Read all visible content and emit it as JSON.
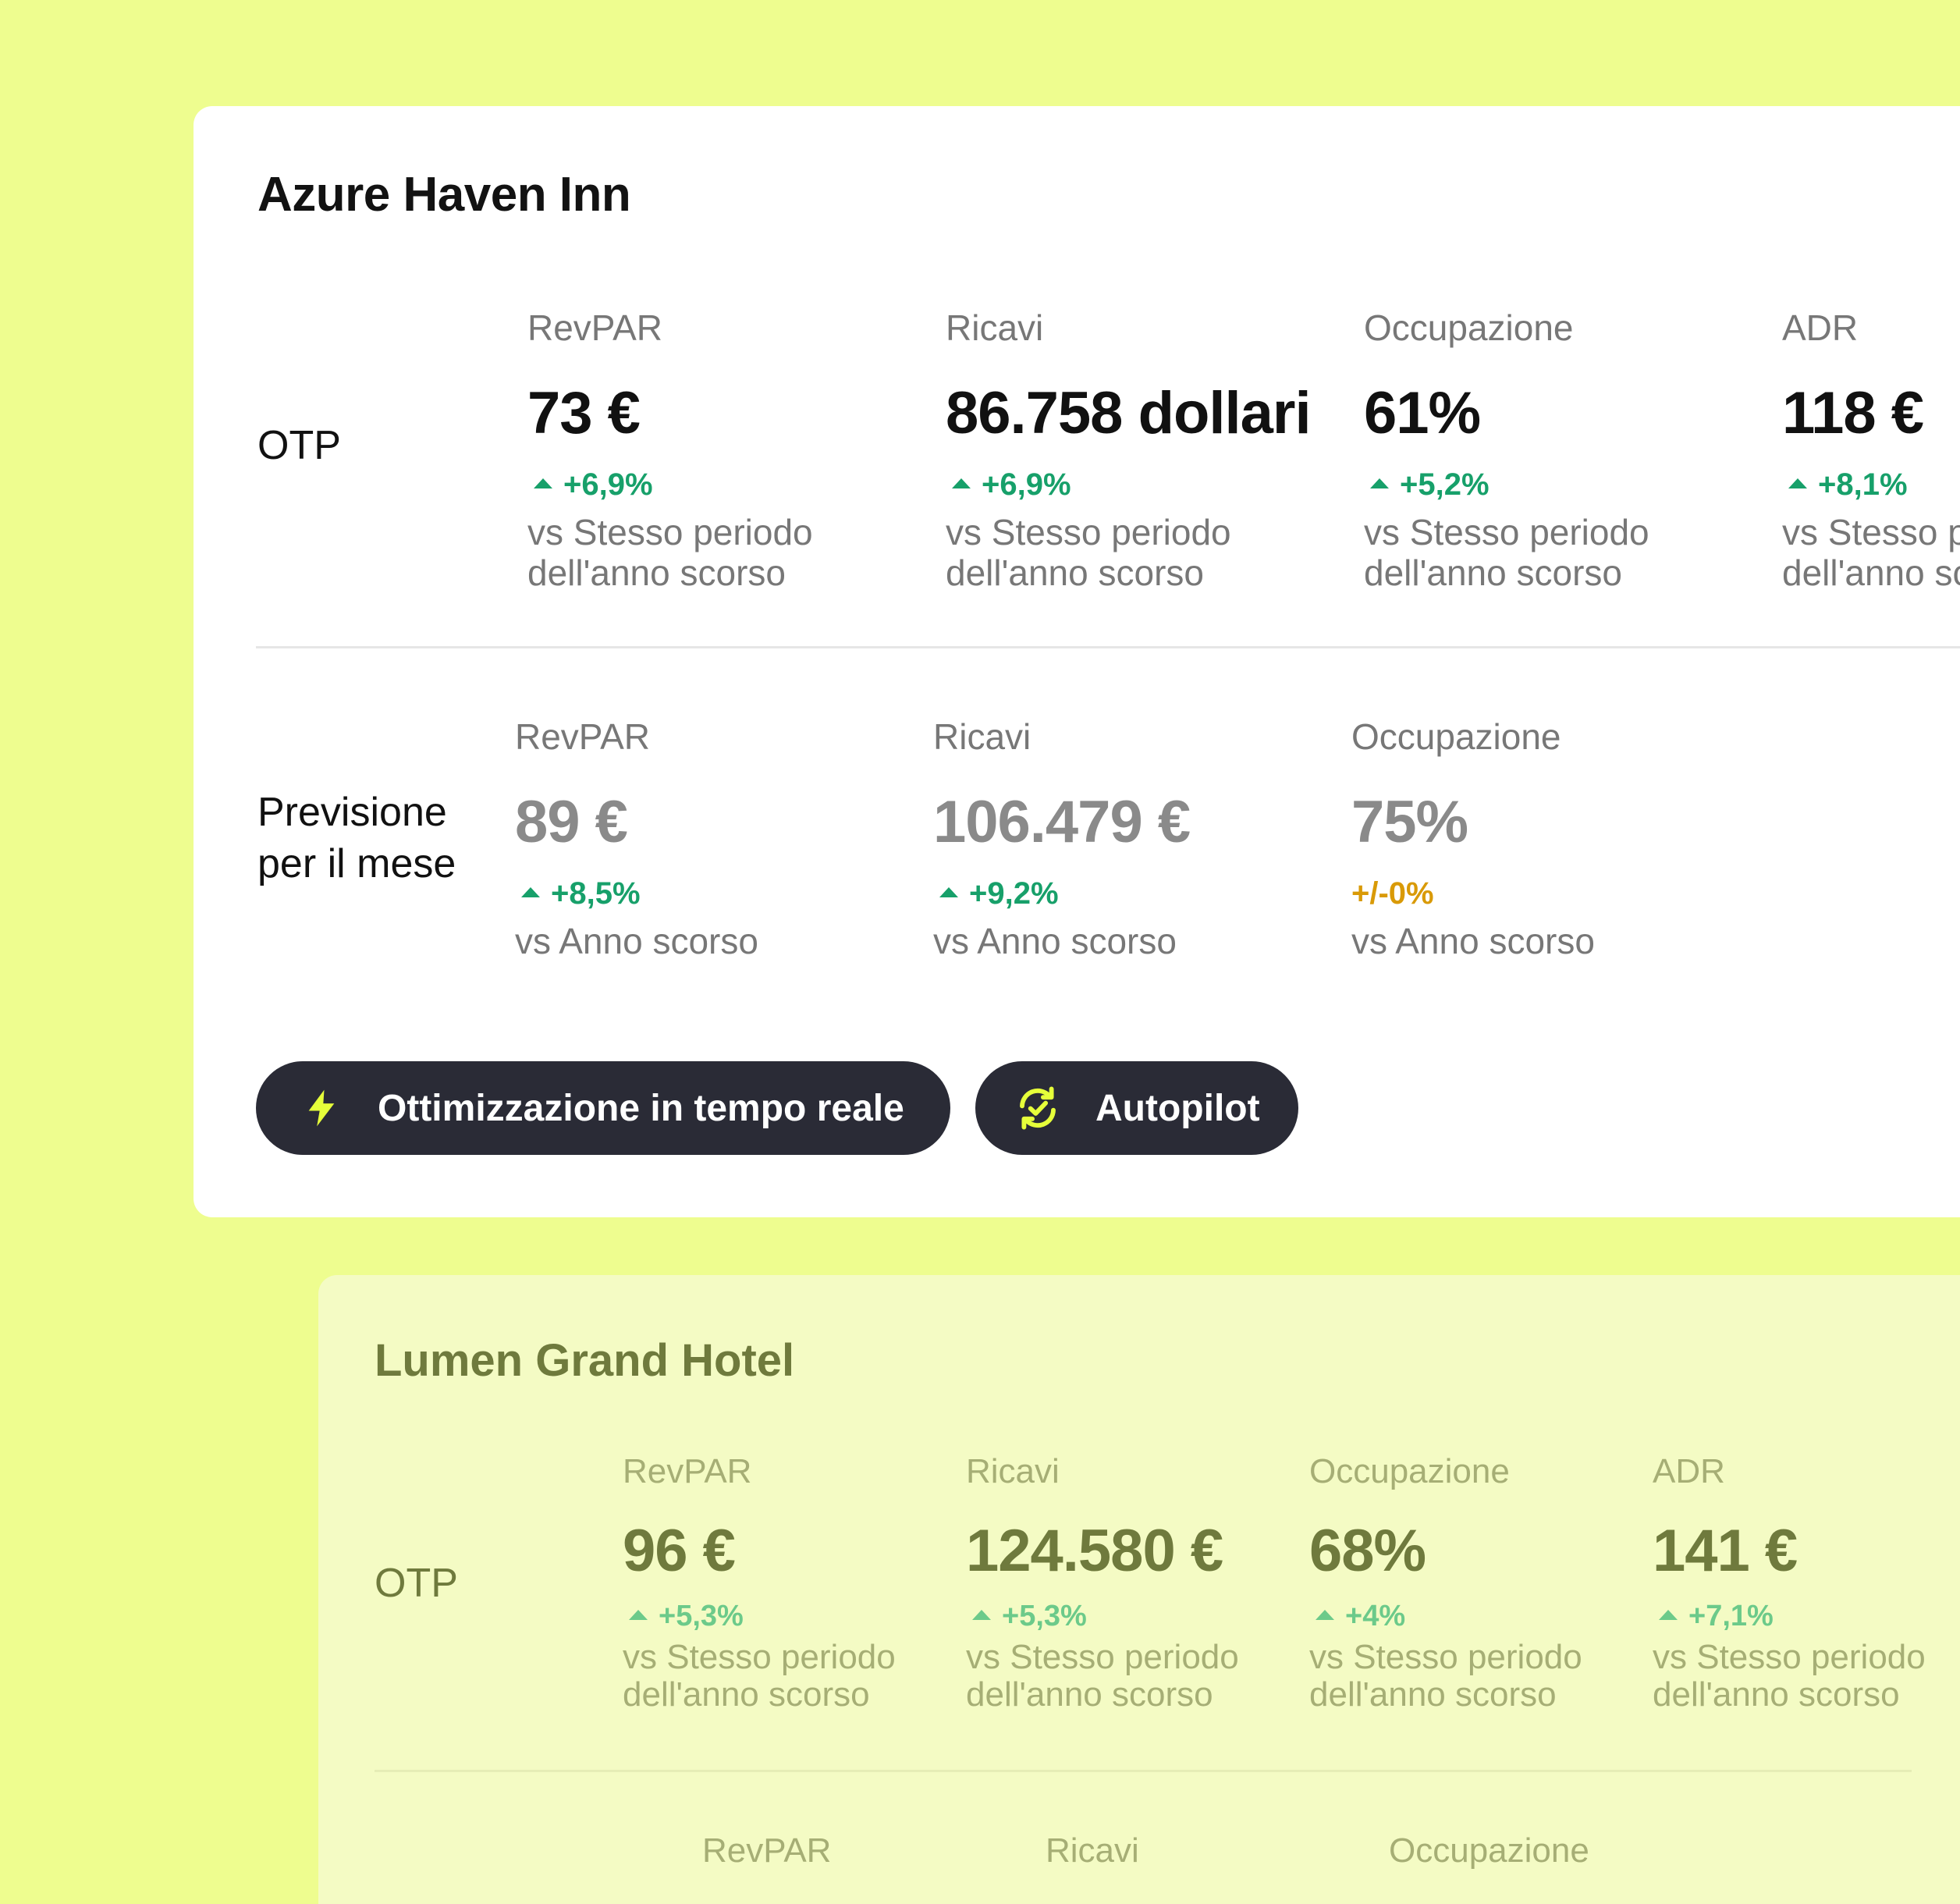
{
  "card1": {
    "hotel": "Azure Haven Inn",
    "otp": {
      "label": "OTP",
      "metrics": [
        {
          "label": "RevPAR",
          "value": "73 €",
          "change": "+6,9%",
          "sub1": "vs Stesso periodo",
          "sub2": "dell'anno scorso"
        },
        {
          "label": "Ricavi",
          "value": "86.758 dollari",
          "change": "+6,9%",
          "sub1": "vs Stesso periodo",
          "sub2": "dell'anno scorso"
        },
        {
          "label": "Occupazione",
          "value": "61%",
          "change": "+5,2%",
          "sub1": "vs Stesso periodo",
          "sub2": "dell'anno scorso"
        },
        {
          "label": "ADR",
          "value": "118 €",
          "change": "+8,1%",
          "sub1": "vs Stesso periodo",
          "sub2": "dell'anno scorso"
        }
      ]
    },
    "forecast": {
      "label_line1": "Previsione",
      "label_line2": "per il mese",
      "metrics": [
        {
          "label": "RevPAR",
          "value": "89 €",
          "change": "+8,5%",
          "sub": "vs Anno scorso"
        },
        {
          "label": "Ricavi",
          "value": "106.479 €",
          "change": "+9,2%",
          "sub": "vs Anno scorso"
        },
        {
          "label": "Occupazione",
          "value": "75%",
          "change": "+/-0%",
          "sub": "vs Anno scorso"
        }
      ]
    },
    "buttons": {
      "realtime": "Ottimizzazione in tempo reale",
      "autopilot": "Autopilot"
    }
  },
  "card2": {
    "hotel": "Lumen Grand Hotel",
    "otp": {
      "label": "OTP",
      "metrics": [
        {
          "label": "RevPAR",
          "value": "96 €",
          "change": "+5,3%",
          "sub1": "vs Stesso periodo",
          "sub2": "dell'anno scorso"
        },
        {
          "label": "Ricavi",
          "value": "124.580 €",
          "change": "+5,3%",
          "sub1": "vs Stesso periodo",
          "sub2": "dell'anno scorso"
        },
        {
          "label": "Occupazione",
          "value": "68%",
          "change": "+4%",
          "sub1": "vs Stesso periodo",
          "sub2": "dell'anno scorso"
        },
        {
          "label": "ADR",
          "value": "141 €",
          "change": "+7,1%",
          "sub1": "vs Stesso periodo",
          "sub2": "dell'anno scorso"
        }
      ]
    },
    "forecast": {
      "metrics": [
        {
          "label": "RevPAR"
        },
        {
          "label": "Ricavi"
        },
        {
          "label": "Occupazione"
        }
      ]
    }
  },
  "colors": {
    "background": "#eefd8f",
    "positive": "#17a06a",
    "neutral": "#d99a07",
    "button_bg": "#2a2b36",
    "icon_accent": "#e6ff3a"
  },
  "icons": {
    "realtime": "lightning-bolt-icon",
    "autopilot": "sync-check-icon"
  }
}
